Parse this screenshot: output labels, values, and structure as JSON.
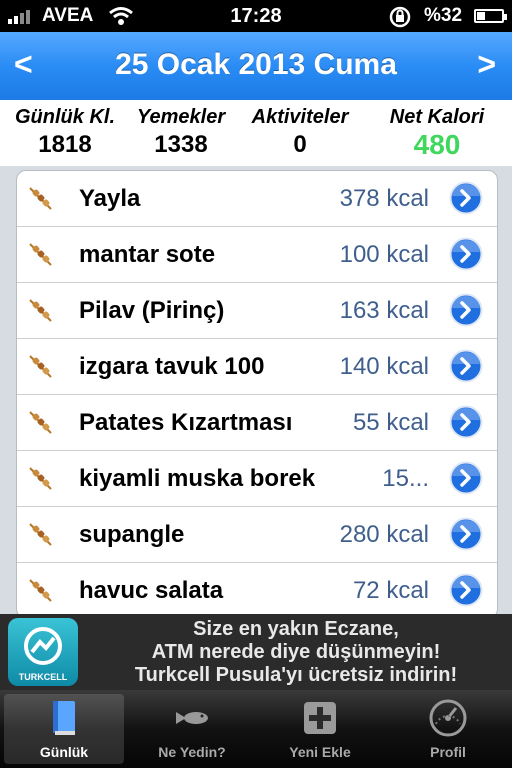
{
  "status_bar": {
    "carrier": "AVEA",
    "time": "17:28",
    "battery_percent": "%32",
    "battery_level": 0.32
  },
  "nav": {
    "prev": "<",
    "title": "25 Ocak 2013 Cuma",
    "next": ">"
  },
  "summary": {
    "daily_label": "Günlük Kl.",
    "daily_value": "1818",
    "meals_label": "Yemekler",
    "meals_value": "1338",
    "activities_label": "Aktiviteler",
    "activities_value": "0",
    "net_label": "Net Kalori",
    "net_value": "480",
    "net_color": "#3fd85c"
  },
  "foods": [
    {
      "name": "Yayla",
      "kcal": "378 kcal"
    },
    {
      "name": "mantar sote",
      "kcal": "100 kcal"
    },
    {
      "name": "Pilav (Pirinç)",
      "kcal": "163 kcal"
    },
    {
      "name": "izgara tavuk 100",
      "kcal": "140 kcal"
    },
    {
      "name": "Patates Kızartması",
      "kcal": "55 kcal"
    },
    {
      "name": "kiyamli muska borek",
      "kcal": "15..."
    },
    {
      "name": "supangle",
      "kcal": "280 kcal"
    },
    {
      "name": "havuc salata",
      "kcal": "72 kcal"
    }
  ],
  "ad": {
    "brand": "TURKCELL",
    "line1": "Size en yakın Eczane,",
    "line2": "ATM nerede diye düşünmeyin!",
    "line3": "Turkcell Pusula'yı ücretsiz indirin!"
  },
  "tabs": [
    {
      "label": "Günlük",
      "icon": "book-icon",
      "active": true
    },
    {
      "label": "Ne Yedin?",
      "icon": "fish-icon",
      "active": false
    },
    {
      "label": "Yeni Ekle",
      "icon": "plus-icon",
      "active": false
    },
    {
      "label": "Profil",
      "icon": "gauge-icon",
      "active": false
    }
  ],
  "colors": {
    "nav_blue": "#2a8cf5",
    "kcal_text": "#3f5e8c",
    "disclosure_blue": "#1f6fe0"
  }
}
